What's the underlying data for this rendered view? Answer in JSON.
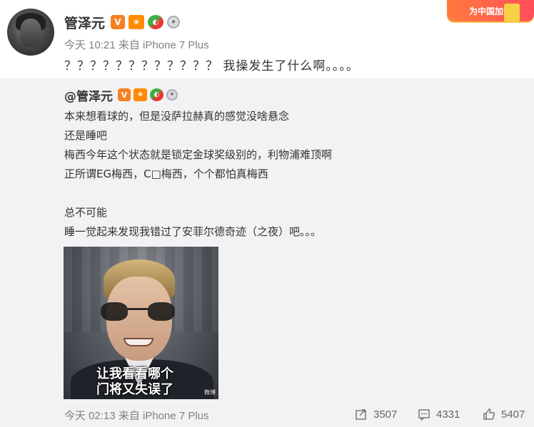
{
  "post": {
    "author": "管泽元",
    "badges": [
      "verified-v-icon",
      "gift-badge-icon",
      "watermelon-badge-icon",
      "medal-badge-icon"
    ],
    "meta": "今天 10:21 来自 iPhone 7 Plus",
    "text": "？？？？？？？？？？？？ 我操发生了什么啊。。。。"
  },
  "promo": {
    "label": "为中国加油"
  },
  "repost": {
    "author": "@管泽元",
    "lines": [
      "本来想看球的，但是没萨拉赫真的感觉没啥悬念",
      "还是睡吧",
      "梅西今年这个状态就是锁定金球奖级别的，利物浦难顶啊",
      "正所谓EG梅西，C□梅西，个个都怕真梅西",
      "总不可能",
      "睡一觉起来发现我错过了安菲尔德奇迹（之夜）吧。。。"
    ],
    "image": {
      "caption_line1": "让我看看哪个",
      "caption_line2": "门将又失误了",
      "watermark": "微博"
    },
    "meta": "今天 02:13 来自 iPhone 7 Plus",
    "actions": {
      "repost_count": "3507",
      "comment_count": "4331",
      "like_count": "5407"
    }
  },
  "colors": {
    "brand_orange": "#f58220",
    "panel_bg": "#f2f2f5",
    "meta_gray": "#808080"
  }
}
